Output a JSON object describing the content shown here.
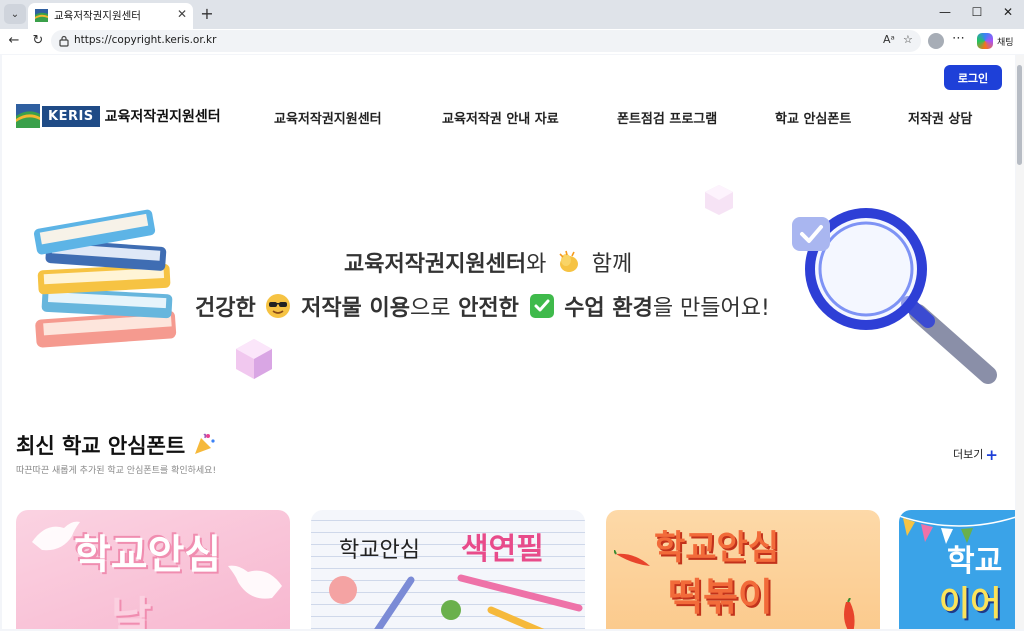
{
  "browser": {
    "tab_title": "교육저작권지원센터",
    "tab_close": "✕",
    "new_tab": "+",
    "url": "https://copyright.keris.or.kr",
    "chat_label": "채팅",
    "window_controls": [
      "—",
      "☐",
      "✕"
    ]
  },
  "header": {
    "login_label": "로그인",
    "logo_abbr": "KERIS",
    "logo_text": "교육저작권지원센터",
    "nav": [
      "교육저작권지원센터",
      "교육저작권 안내 자료",
      "폰트점검 프로그램",
      "학교 안심폰트",
      "저작권 상담"
    ]
  },
  "hero": {
    "line1_bold": "교육저작권지원센터",
    "line1_rest": "와",
    "line1_end": "함께",
    "line2_a": "건강한",
    "line2_b": "저작물 이용",
    "line2_c": "으로",
    "line2_d": "안전한",
    "line2_e": "수업 환경",
    "line2_f": "을 만들어요!"
  },
  "section": {
    "title": "최신 학교 안심폰트",
    "subtitle": "따끈따끈 새롭게 추가된 학교 안심폰트를 확인하세요!",
    "more_label": "더보기"
  },
  "cards": [
    {
      "title": "학교안심",
      "sub": "날"
    },
    {
      "title_a": "학교안심",
      "title_b": "색연필"
    },
    {
      "title": "학교안심",
      "sub": "떡볶이"
    },
    {
      "title": "학교",
      "sub": "이어"
    }
  ],
  "colors": {
    "accent": "#1e40d8",
    "logo_navy": "#1f4b86"
  }
}
